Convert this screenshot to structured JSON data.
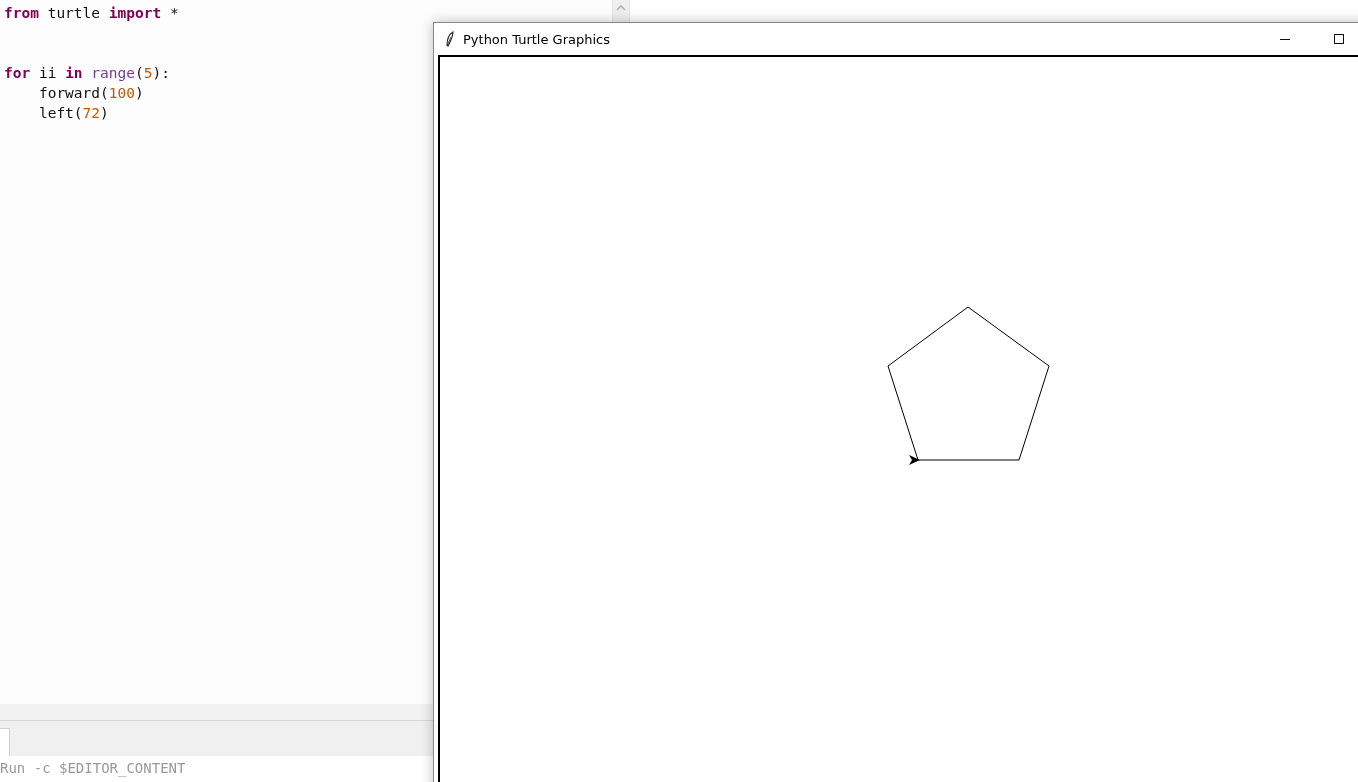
{
  "editor": {
    "blocks": [
      {
        "lines": [
          {
            "tokens": [
              {
                "kind": "keyword",
                "text": "from"
              },
              {
                "kind": "plain",
                "text": " turtle "
              },
              {
                "kind": "keyword",
                "text": "import"
              },
              {
                "kind": "plain",
                "text": " *"
              }
            ]
          }
        ]
      },
      {
        "lines": [
          {
            "tokens": [
              {
                "kind": "keyword",
                "text": "for"
              },
              {
                "kind": "plain",
                "text": " ii "
              },
              {
                "kind": "keyword",
                "text": "in "
              },
              {
                "kind": "builtin",
                "text": "range"
              },
              {
                "kind": "plain",
                "text": "("
              },
              {
                "kind": "number",
                "text": "5"
              },
              {
                "kind": "plain",
                "text": "):"
              }
            ]
          },
          {
            "tokens": [
              {
                "kind": "plain",
                "text": "    forward("
              },
              {
                "kind": "number",
                "text": "100"
              },
              {
                "kind": "plain",
                "text": ")"
              }
            ]
          },
          {
            "tokens": [
              {
                "kind": "plain",
                "text": "    left("
              },
              {
                "kind": "number",
                "text": "72"
              },
              {
                "kind": "plain",
                "text": ")"
              }
            ]
          }
        ]
      }
    ]
  },
  "shell": {
    "command": "Run -c $EDITOR_CONTENT"
  },
  "turtle_window": {
    "title": "Python Turtle Graphics"
  }
}
